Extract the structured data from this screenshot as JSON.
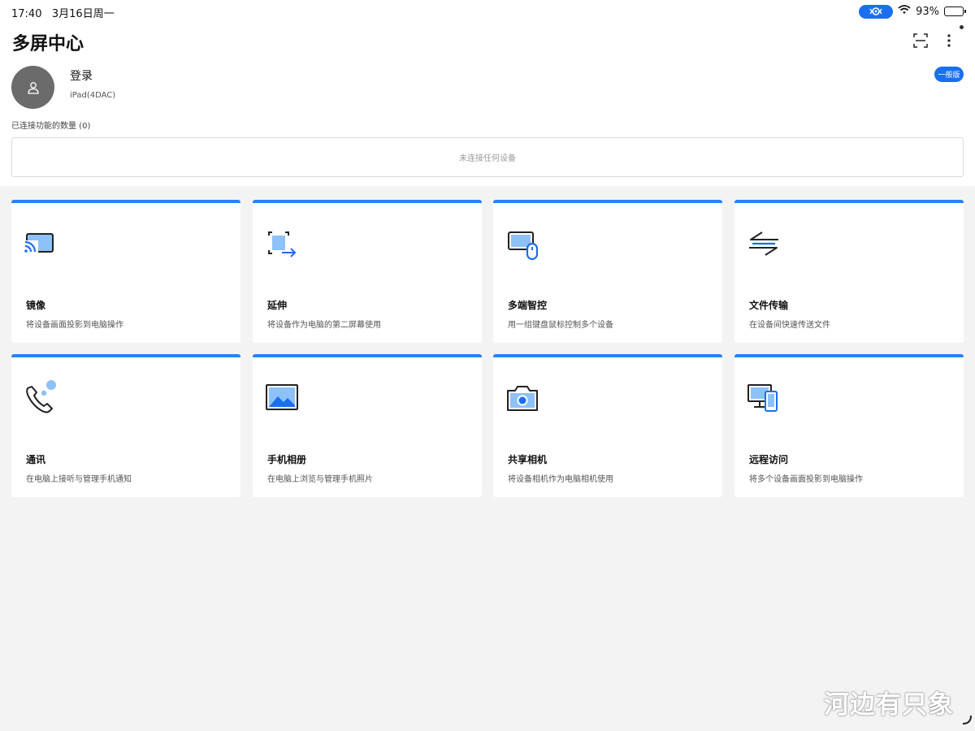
{
  "status_bar": {
    "time": "17:40",
    "date": "3月16日周一",
    "battery_percent": "93%",
    "battery_level": 0.93,
    "icons": [
      "screen-mirror-icon",
      "wifi-icon",
      "battery-icon"
    ]
  },
  "header": {
    "title": "多屏中心",
    "icons": [
      "scan-icon",
      "more-vertical-icon"
    ]
  },
  "account": {
    "login_label": "登录",
    "device_name": "iPad(4DAC)",
    "edition_badge": "一般版",
    "avatar_icon": "user-icon"
  },
  "connection": {
    "count_label": "已连接功能的数量 (0)",
    "empty_message": "未连接任何设备"
  },
  "features": [
    {
      "title": "镜像",
      "desc": "将设备画面投影到电脑操作",
      "icon": "cast-icon"
    },
    {
      "title": "延伸",
      "desc": "将设备作为电脑的第二屏幕使用",
      "icon": "extend-screen-icon"
    },
    {
      "title": "多端智控",
      "desc": "用一组键盘鼠标控制多个设备",
      "icon": "monitor-mouse-icon"
    },
    {
      "title": "文件传输",
      "desc": "在设备间快速传送文件",
      "icon": "transfer-arrows-icon"
    },
    {
      "title": "通讯",
      "desc": "在电脑上接听与管理手机通知",
      "icon": "phone-icon"
    },
    {
      "title": "手机相册",
      "desc": "在电脑上浏览与管理手机照片",
      "icon": "photo-icon"
    },
    {
      "title": "共享相机",
      "desc": "将设备相机作为电脑相机使用",
      "icon": "camera-icon"
    },
    {
      "title": "远程访问",
      "desc": "将多个设备画面投影到电脑操作",
      "icon": "remote-devices-icon"
    }
  ],
  "watermark": "河边有只象",
  "colors": {
    "accent": "#2a83ee",
    "badge_blue": "#1a6ef0",
    "icon_light_blue": "#8ec1f7",
    "background": "#f3f3f3"
  }
}
